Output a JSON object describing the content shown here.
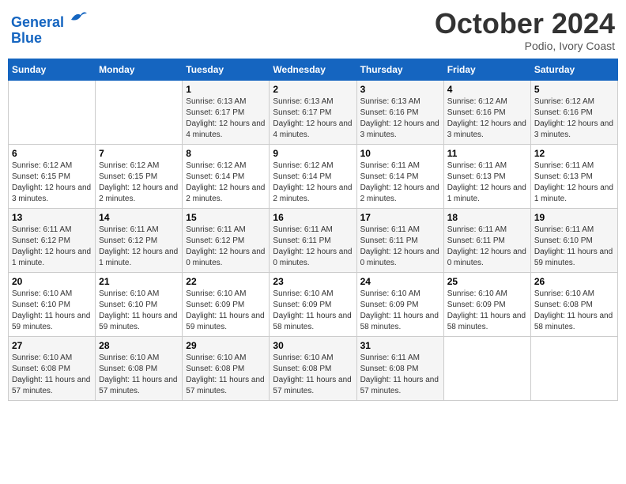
{
  "logo": {
    "line1": "General",
    "line2": "Blue"
  },
  "title": "October 2024",
  "location": "Podio, Ivory Coast",
  "days_header": [
    "Sunday",
    "Monday",
    "Tuesday",
    "Wednesday",
    "Thursday",
    "Friday",
    "Saturday"
  ],
  "weeks": [
    [
      {
        "day": "",
        "info": ""
      },
      {
        "day": "",
        "info": ""
      },
      {
        "day": "1",
        "info": "Sunrise: 6:13 AM\nSunset: 6:17 PM\nDaylight: 12 hours and 4 minutes."
      },
      {
        "day": "2",
        "info": "Sunrise: 6:13 AM\nSunset: 6:17 PM\nDaylight: 12 hours and 4 minutes."
      },
      {
        "day": "3",
        "info": "Sunrise: 6:13 AM\nSunset: 6:16 PM\nDaylight: 12 hours and 3 minutes."
      },
      {
        "day": "4",
        "info": "Sunrise: 6:12 AM\nSunset: 6:16 PM\nDaylight: 12 hours and 3 minutes."
      },
      {
        "day": "5",
        "info": "Sunrise: 6:12 AM\nSunset: 6:16 PM\nDaylight: 12 hours and 3 minutes."
      }
    ],
    [
      {
        "day": "6",
        "info": "Sunrise: 6:12 AM\nSunset: 6:15 PM\nDaylight: 12 hours and 3 minutes."
      },
      {
        "day": "7",
        "info": "Sunrise: 6:12 AM\nSunset: 6:15 PM\nDaylight: 12 hours and 2 minutes."
      },
      {
        "day": "8",
        "info": "Sunrise: 6:12 AM\nSunset: 6:14 PM\nDaylight: 12 hours and 2 minutes."
      },
      {
        "day": "9",
        "info": "Sunrise: 6:12 AM\nSunset: 6:14 PM\nDaylight: 12 hours and 2 minutes."
      },
      {
        "day": "10",
        "info": "Sunrise: 6:11 AM\nSunset: 6:14 PM\nDaylight: 12 hours and 2 minutes."
      },
      {
        "day": "11",
        "info": "Sunrise: 6:11 AM\nSunset: 6:13 PM\nDaylight: 12 hours and 1 minute."
      },
      {
        "day": "12",
        "info": "Sunrise: 6:11 AM\nSunset: 6:13 PM\nDaylight: 12 hours and 1 minute."
      }
    ],
    [
      {
        "day": "13",
        "info": "Sunrise: 6:11 AM\nSunset: 6:12 PM\nDaylight: 12 hours and 1 minute."
      },
      {
        "day": "14",
        "info": "Sunrise: 6:11 AM\nSunset: 6:12 PM\nDaylight: 12 hours and 1 minute."
      },
      {
        "day": "15",
        "info": "Sunrise: 6:11 AM\nSunset: 6:12 PM\nDaylight: 12 hours and 0 minutes."
      },
      {
        "day": "16",
        "info": "Sunrise: 6:11 AM\nSunset: 6:11 PM\nDaylight: 12 hours and 0 minutes."
      },
      {
        "day": "17",
        "info": "Sunrise: 6:11 AM\nSunset: 6:11 PM\nDaylight: 12 hours and 0 minutes."
      },
      {
        "day": "18",
        "info": "Sunrise: 6:11 AM\nSunset: 6:11 PM\nDaylight: 12 hours and 0 minutes."
      },
      {
        "day": "19",
        "info": "Sunrise: 6:11 AM\nSunset: 6:10 PM\nDaylight: 11 hours and 59 minutes."
      }
    ],
    [
      {
        "day": "20",
        "info": "Sunrise: 6:10 AM\nSunset: 6:10 PM\nDaylight: 11 hours and 59 minutes."
      },
      {
        "day": "21",
        "info": "Sunrise: 6:10 AM\nSunset: 6:10 PM\nDaylight: 11 hours and 59 minutes."
      },
      {
        "day": "22",
        "info": "Sunrise: 6:10 AM\nSunset: 6:09 PM\nDaylight: 11 hours and 59 minutes."
      },
      {
        "day": "23",
        "info": "Sunrise: 6:10 AM\nSunset: 6:09 PM\nDaylight: 11 hours and 58 minutes."
      },
      {
        "day": "24",
        "info": "Sunrise: 6:10 AM\nSunset: 6:09 PM\nDaylight: 11 hours and 58 minutes."
      },
      {
        "day": "25",
        "info": "Sunrise: 6:10 AM\nSunset: 6:09 PM\nDaylight: 11 hours and 58 minutes."
      },
      {
        "day": "26",
        "info": "Sunrise: 6:10 AM\nSunset: 6:08 PM\nDaylight: 11 hours and 58 minutes."
      }
    ],
    [
      {
        "day": "27",
        "info": "Sunrise: 6:10 AM\nSunset: 6:08 PM\nDaylight: 11 hours and 57 minutes."
      },
      {
        "day": "28",
        "info": "Sunrise: 6:10 AM\nSunset: 6:08 PM\nDaylight: 11 hours and 57 minutes."
      },
      {
        "day": "29",
        "info": "Sunrise: 6:10 AM\nSunset: 6:08 PM\nDaylight: 11 hours and 57 minutes."
      },
      {
        "day": "30",
        "info": "Sunrise: 6:10 AM\nSunset: 6:08 PM\nDaylight: 11 hours and 57 minutes."
      },
      {
        "day": "31",
        "info": "Sunrise: 6:11 AM\nSunset: 6:08 PM\nDaylight: 11 hours and 57 minutes."
      },
      {
        "day": "",
        "info": ""
      },
      {
        "day": "",
        "info": ""
      }
    ]
  ]
}
